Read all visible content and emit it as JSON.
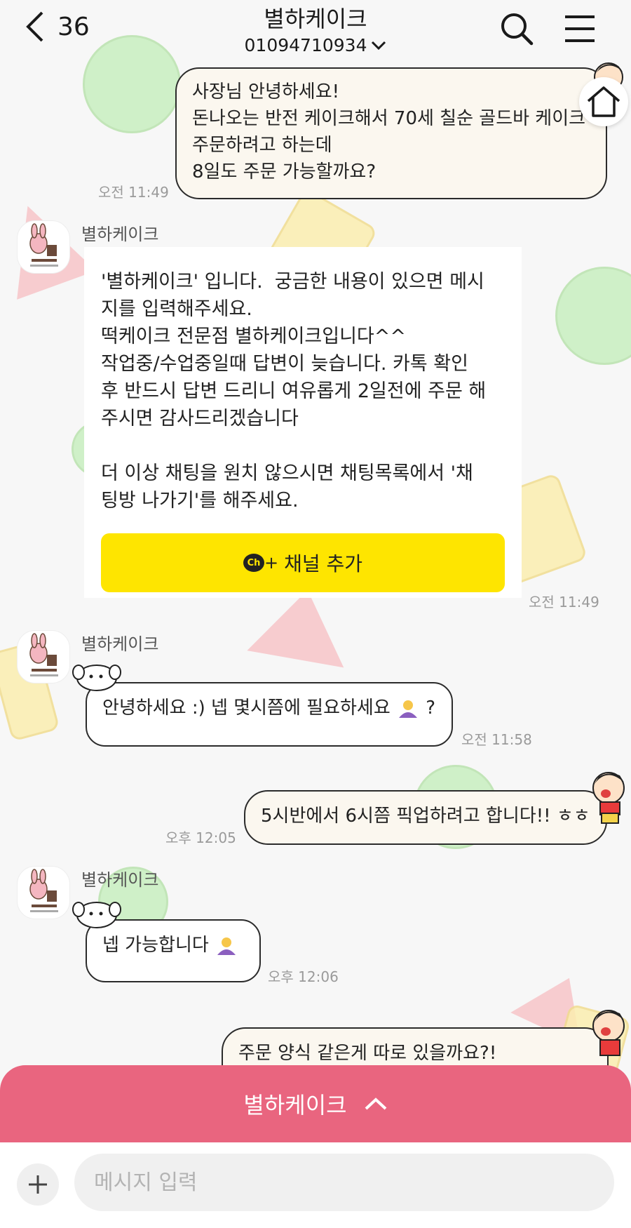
{
  "header": {
    "unread_count": "36",
    "title": "별하케이크",
    "phone": "01094710934"
  },
  "messages": {
    "m1": {
      "lines": [
        "사장님 안녕하세요!",
        "돈나오는 반전 케이크해서 70세 칠순 골드바 케이크",
        "주문하려고 하는데",
        "8일도 주문 가능할까요?"
      ],
      "time": "오전 11:49"
    },
    "system": {
      "sender": "별하케이크",
      "text": "'별하케이크' 입니다.  궁금한 내용이 있으면 메시\n지를 입력해주세요.\n떡케이크 전문점 별하케이크입니다^^\n작업중/수업중일때 답변이 늦습니다. 카톡 확인\n후 반드시 답변 드리니 여유롭게 2일전에 주문 해\n주시면 감사드리겠습니다\n\n더 이상 채팅을 원치 않으시면 채팅목록에서 '채\n팅방 나가기'를 해주세요.",
      "channel_button": "채널 추가",
      "time": "오전 11:49"
    },
    "m2": {
      "sender": "별하케이크",
      "text": "안녕하세요 :) 넵 몇시쯤에 필요하세요",
      "suffix": "?",
      "time": "오전 11:58"
    },
    "m3": {
      "text": "5시반에서 6시쯤 픽업하려고 합니다!! ㅎㅎ",
      "time": "오후 12:05"
    },
    "m4": {
      "sender": "별하케이크",
      "text": "넵 가능합니다",
      "time": "오후 12:06"
    },
    "m5": {
      "text": "주문 양식 같은게 따로 있을까요?!"
    }
  },
  "bottom_bar": {
    "label": "별하케이크"
  },
  "composer": {
    "placeholder": "메시지 입력"
  },
  "colors": {
    "bottom_bar": "#e9657f",
    "channel_button": "#fee500",
    "my_bubble": "#fbf7ef"
  },
  "icons": [
    "back-chevron-icon",
    "search-icon",
    "menu-icon",
    "home-icon",
    "plus-icon",
    "chevron-up-icon",
    "channel-icon"
  ]
}
